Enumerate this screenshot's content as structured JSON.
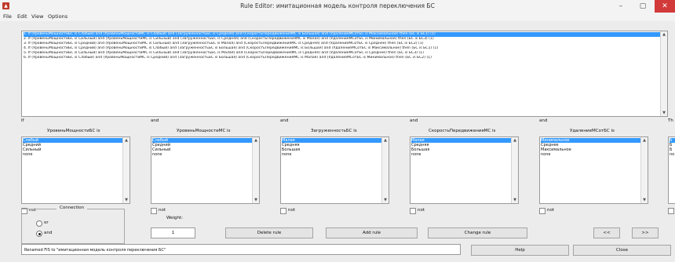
{
  "window": {
    "title": "Rule Editor: имитационная модель контроля переключения БС",
    "minimize_glyph": "–",
    "maximize_glyph": "▢",
    "close_glyph": "✕"
  },
  "menu": [
    "File",
    "Edit",
    "View",
    "Options"
  ],
  "rules": [
    "1. If (УровеньМощностиБС is Слабый) and (УровеньМощностиМС is Слабый) and (ЗагруженностьБС is Средняя) and (СкоростьПередвиженияМС is Большая) and (УдалениеМСотБС is Максимальное) then (БС is БС1) (1)",
    "2. If (УровеньМощностиБС is Сильный) and (УровеньМощностиМС is Сильный) and (ЗагруженностьБС is Средняя) and (СкоростьПередвиженияМС is Малая) and (УдалениеМСотБС is Минимальное) then (БС is БС3) (1)",
    "3. If (УровеньМощностиБС is Средний) and (УровеньМощностиМС is Сильный) and (ЗагруженностьБС is Малая) and (СкоростьПередвиженияМС is Средняя) and (УдалениеМСотБС is Среднее) then (БС is БС2) (1)",
    "4. If (УровеньМощностиБС is Средний) and (УровеньМощностиМС is Слабый) and (ЗагруженностьБС is Большая) and (СкоростьПередвиженияМС is Большая) and (УдалениеМСотБС is Максимальное) then (БС is БС1) (1)",
    "5. If (УровеньМощностиБС is Сильный) and (УровеньМощностиМС is Сильный) and (ЗагруженностьБС is Малая) and (СкоростьПередвиженияМС is Средняя) and (УдалениеМСотБС is Среднее) then (БС is БС3) (1)",
    "6. If (УровеньМощностиБС is Слабый) and (УровеньМощностиМС is Средний) and (ЗагруженностьБС is Большая) and (СкоростьПередвиженияМС is Малая) and (УдалениеМСотБС is Минимальное) then (БС is БС2) (1)"
  ],
  "selected_rule_index": 0,
  "antecedents": [
    {
      "keyword": "If",
      "name": "УровеньМощностиБС is",
      "options": [
        "Слабый",
        "Средний",
        "Сильный",
        "none"
      ],
      "selected": 0
    },
    {
      "keyword": "and",
      "name": "УровеньМощностиМС is",
      "options": [
        "Слабый",
        "Средний",
        "Сильный",
        "none"
      ],
      "selected": 0
    },
    {
      "keyword": "and",
      "name": "ЗагруженностьБС is",
      "options": [
        "Малая",
        "Средняя",
        "Большая",
        "none"
      ],
      "selected": 0
    },
    {
      "keyword": "and",
      "name": "СкоростьПередвиженияМС is",
      "options": [
        "Малая",
        "Средняя",
        "Большая",
        "none"
      ],
      "selected": 0
    },
    {
      "keyword": "and",
      "name": "УдалениеМСотБС is",
      "options": [
        "Минимальное",
        "Среднее",
        "Максимальное",
        "none"
      ],
      "selected": 0
    },
    {
      "keyword": "Th",
      "name": "",
      "options": [
        "Б",
        "Б",
        "Б",
        "no"
      ],
      "selected": 0
    }
  ],
  "not_label": "not",
  "connection": {
    "title": "Connection",
    "or_label": "or",
    "and_label": "and",
    "selected": "and"
  },
  "weight": {
    "label": "Weight:",
    "value": "1"
  },
  "buttons": {
    "delete": "Delete rule",
    "add": "Add rule",
    "change": "Change rule",
    "prev": "<<",
    "next": ">>",
    "help": "Help",
    "close": "Close"
  },
  "status": "Renamed FIS to \"имитационная модель контроля переключения БС\"",
  "colors": {
    "selection": "#3399ff",
    "close_button": "#d23a3a"
  }
}
